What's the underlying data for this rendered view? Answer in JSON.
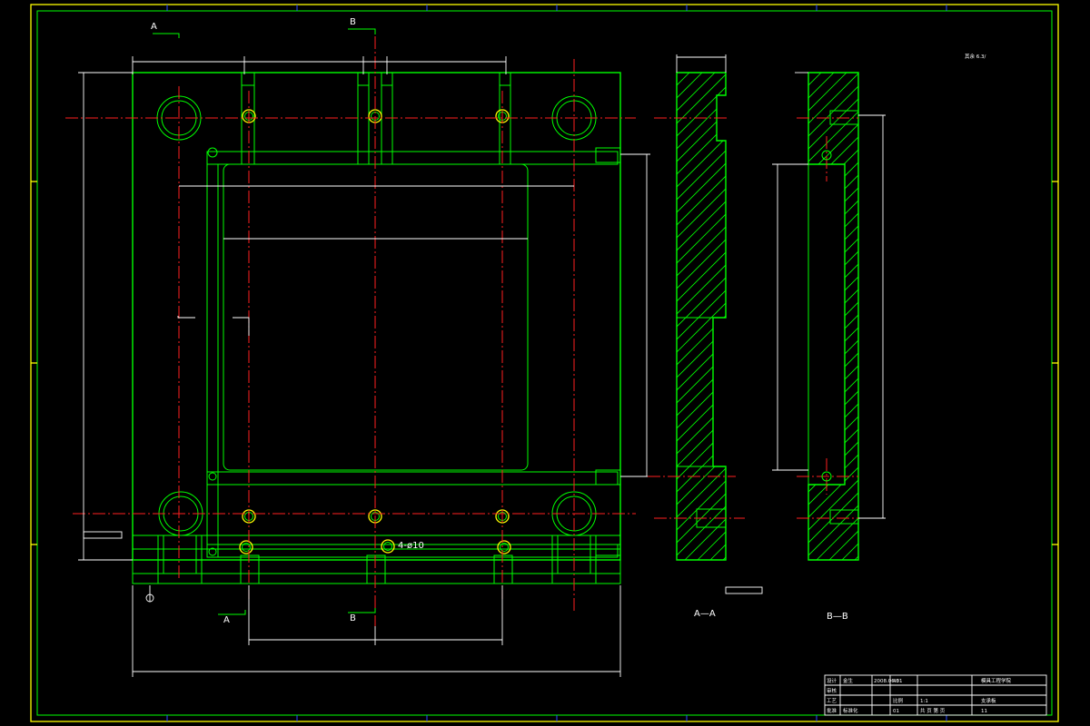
{
  "colors": {
    "background": "#000000",
    "outline": "#00ff00",
    "centerline": "#ff2020",
    "dimension": "#ffffff",
    "hole_highlight": "#ffff00",
    "border_outer": "#ffff00",
    "tick_marks": "#2a4cff"
  },
  "section_marks": {
    "a_top": "A",
    "b_top": "B",
    "a_bottom": "A",
    "b_bottom": "B"
  },
  "view_labels": {
    "section_aa": "A—A",
    "section_bb": "B—B"
  },
  "annotations": {
    "hole_callout": "4-ø10",
    "roughness_note": "其余 6.3/"
  },
  "title_block": {
    "row1": [
      "设计",
      "金生",
      "2008.06.01",
      "45",
      "",
      "模具工程学院"
    ],
    "row2": [
      "审核",
      "",
      "",
      "",
      "",
      ""
    ],
    "row3": [
      "工艺",
      "",
      "",
      "比例",
      "1:1",
      "支承板"
    ],
    "row4": [
      "批准",
      "标准化",
      "",
      "01",
      "共 页 第 页",
      "11"
    ]
  }
}
